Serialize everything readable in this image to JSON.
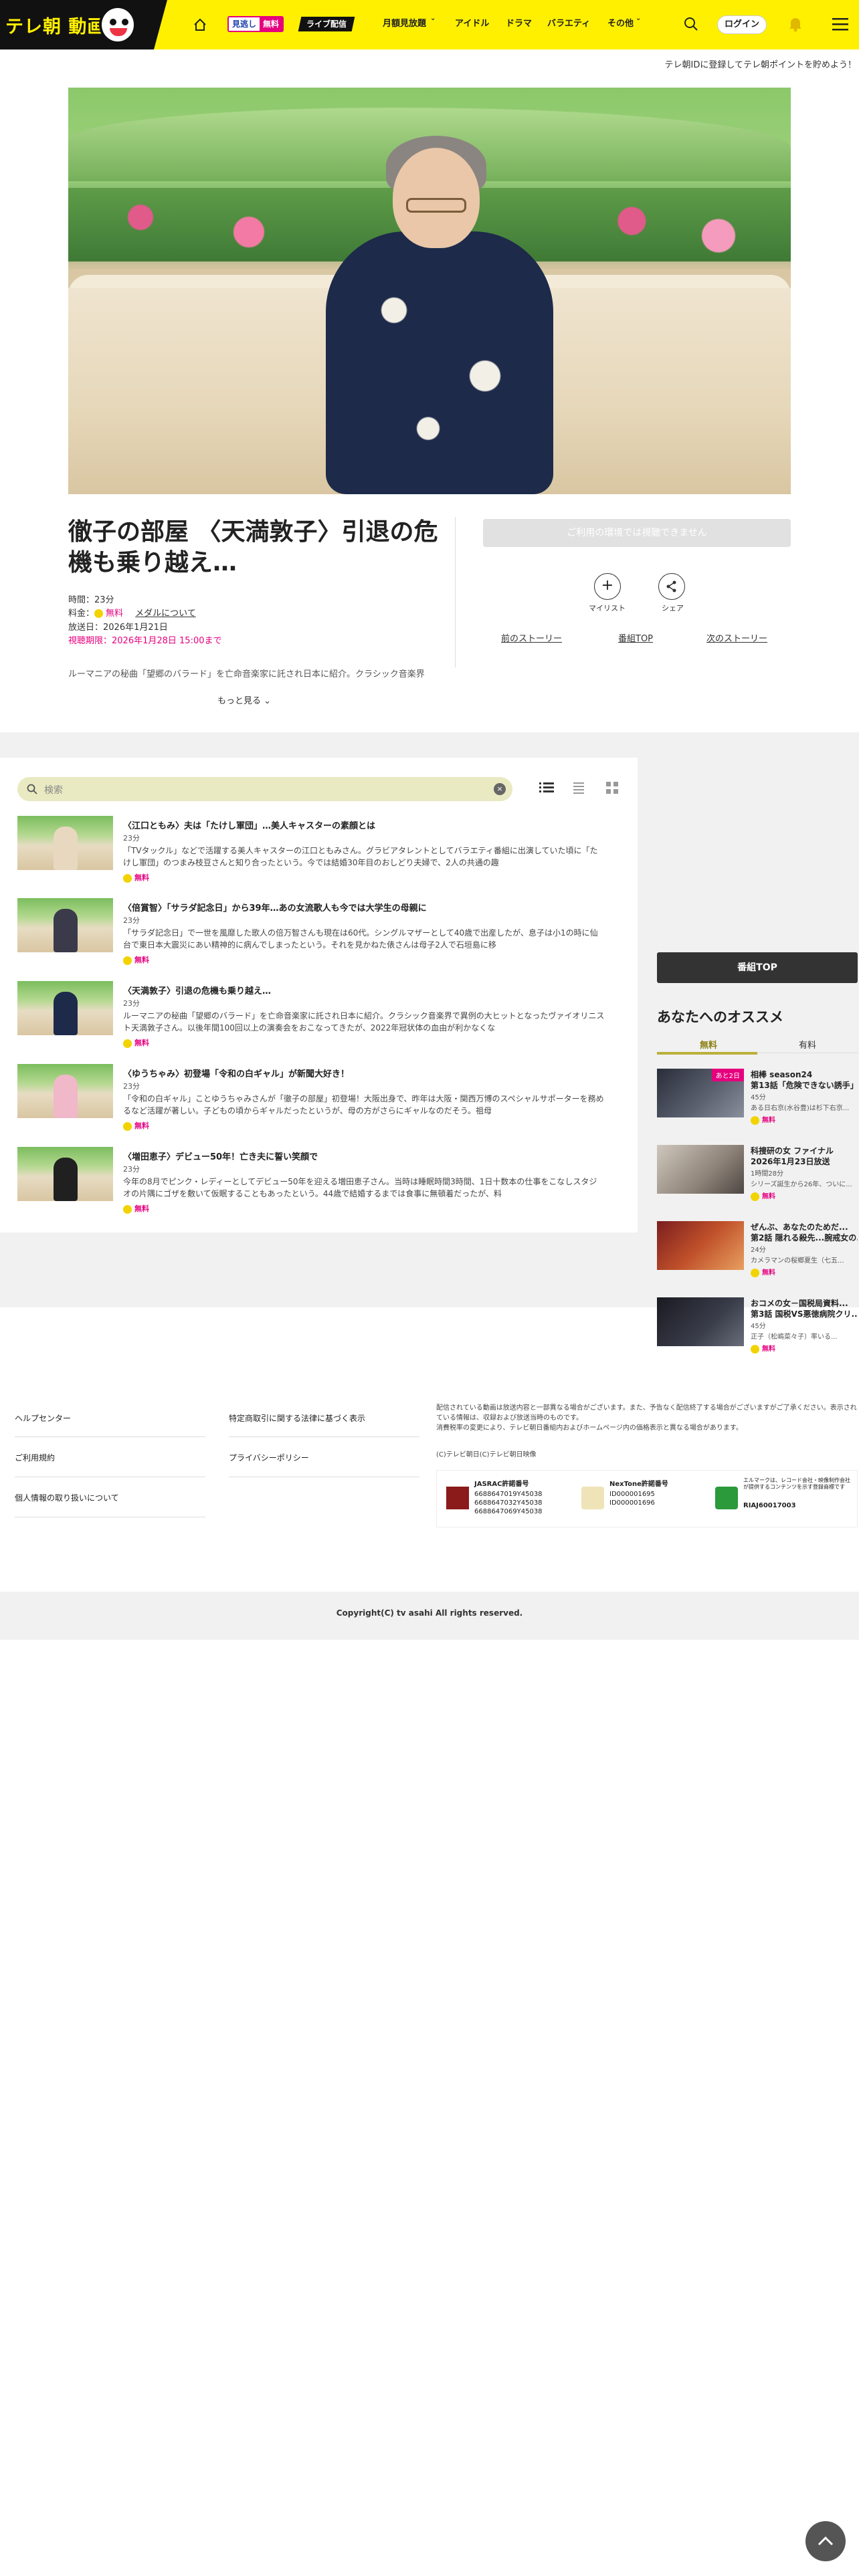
{
  "header": {
    "logo_text": "テレ朝 動画",
    "free_badge_a": "見逃し",
    "free_badge_b": "無料",
    "live_badge": "ライブ配信",
    "nav": [
      "月額見放題",
      "アイドル",
      "ドラマ",
      "バラエティ",
      "その他"
    ],
    "login": "ログイン",
    "banner": "テレ朝IDに登録してテレ朝ポイントを貯めよう！"
  },
  "episode": {
    "title": "徹子の部屋 〈天満敦子〉引退の危機も乗り越え…",
    "duration": "時間：23分",
    "price_label": "料金：",
    "price_value": "無料",
    "medal_link": "メダルについて",
    "broadcast": "放送日：2026年1月21日",
    "deadline": "視聴期限：2026年1月28日 15:00まで",
    "description": "ルーマニアの秘曲「望郷のバラード」を亡命音楽家に託され日本に紹介。クラシック音楽界",
    "more": "もっと見る",
    "disabled_button": "ご利用の環境では視聴できません",
    "mylist": "マイリスト",
    "share": "シェア",
    "prev": "前のストーリー",
    "program_top": "番組TOP",
    "next": "次のストーリー"
  },
  "list": {
    "search_placeholder": "検索",
    "items": [
      {
        "title": "〈江口ともみ〉夫は「たけし軍団」…美人キャスターの素顔とは",
        "duration": "23分",
        "summary": "「TVタックル」などで活躍する美人キャスターの江口ともみさん。グラビアタレントとしてバラエティ番組に出演していた頃に「たけし軍団」のつまみ枝豆さんと知り合ったという。今では結婚30年目のおしどり夫婦で、2人の共通の趣",
        "free": "無料"
      },
      {
        "title": "〈倍賞智〉「サラダ記念日」から39年…あの女流歌人も今では大学生の母親に",
        "duration": "23分",
        "summary": "「サラダ記念日」で一世を風靡した歌人の倍万智さんも現在は60代。シングルマザーとして40歳で出産したが、息子は小1の時に仙台で東日本大震災にあい精神的に病んでしまったという。それを見かねた俵さんは母子2人で石垣島に移",
        "free": "無料"
      },
      {
        "title": "〈天満敦子〉引退の危機も乗り越え…",
        "duration": "23分",
        "summary": "ルーマニアの秘曲「望郷のバラード」を亡命音楽家に託され日本に紹介。クラシック音楽界で異例の大ヒットとなったヴァイオリニスト天満敦子さん。以後年間100回以上の演奏会をおこなってきたが、2022年冠状体の血由が利かなくな",
        "free": "無料"
      },
      {
        "title": "〈ゆうちゃみ〉初登場「令和の白ギャル」が新聞大好き！",
        "duration": "23分",
        "summary": "「令和の白ギャル」ことゆうちゃみさんが「徹子の部屋」初登場！大阪出身で、昨年は大阪・関西万博のスペシャルサポーターを務めるなど活躍が著しい。子どもの頃からギャルだったというが、母の方がさらにギャルなのだそう。祖母",
        "free": "無料"
      },
      {
        "title": "〈増田恵子〉デビュー50年！亡き夫に誓い笑顔で",
        "duration": "23分",
        "summary": "今年の8月でピンク・レディーとしてデビュー50年を迎える増田恵子さん。当時は睡眠時間3時間、1日十数本の仕事をこなしスタジオの片隅にゴザを敷いて仮眠することもあったという。44歳で結婚するまでは食事に無頓着だったが、料",
        "free": "無料"
      }
    ]
  },
  "sidebar": {
    "top_button": "番組TOP",
    "recommend_title": "あなたへのオススメ",
    "tab_free": "無料",
    "tab_paid": "有料",
    "items": [
      {
        "title": "相棒 season24",
        "sub": "第13話「危険できない誘手」",
        "duration": "45分",
        "summary": "ある日右京(水谷豊)は杉下右京...",
        "free": "無料",
        "badge": "あと2日"
      },
      {
        "title": "科捜研の女 ファイナル",
        "sub": "2026年1月23日放送",
        "duration": "1時間28分",
        "summary": "シリーズ誕生から26年、ついに...",
        "free": "無料",
        "badge": ""
      },
      {
        "title": "ぜんぶ、あなたのためだ...",
        "sub": "第2話 隠れる殺先...腕戒女の...",
        "duration": "24分",
        "summary": "カメラマンの桜郷夏生（七五...",
        "free": "無料",
        "badge": ""
      },
      {
        "title": "おコメの女－国税局資料...",
        "sub": "第3話 国税VS悪徳病院クリ...",
        "duration": "45分",
        "summary": "正子（松嶋菜々子）率いる...",
        "free": "無料",
        "badge": ""
      }
    ]
  },
  "footer": {
    "links_left": [
      "ヘルプセンター",
      "ご利用規約",
      "個人情報の取り扱いについて"
    ],
    "links_right": [
      "特定商取引に関する法律に基づく表示",
      "プライバシーポリシー"
    ],
    "note": "配信されている動画は放送内容と一部異なる場合がございます。また、予告なく配信終了する場合がございますがご了承ください。表示されている情報は、収録および放送当時のものです。\n消費税率の変更により、テレビ朝日番組内およびホームページ内の価格表示と異なる場合があります。",
    "copyright_small": "(C)テレビ朝日(C)テレビ朝日映像",
    "jasrac_title": "JASRAC許諾番号",
    "jasrac_nums": [
      "6688647019Y45038",
      "6688647032Y45038",
      "6688647069Y45038"
    ],
    "nextone_title": "NexTone許諾番号",
    "nextone_nums": [
      "ID000001695",
      "ID000001696"
    ],
    "riaj_text": "エルマークは、レコード会社・映像制作会社が提供するコンテンツを示す登録商標です",
    "riaj_num": "RIAJ60017003",
    "copyright": "Copyright(C) tv asahi All rights reserved."
  },
  "colors": {
    "header_yellow": "#fff000",
    "free_pink": "#e6007e",
    "free_badge_yellow": "#f2d300"
  }
}
